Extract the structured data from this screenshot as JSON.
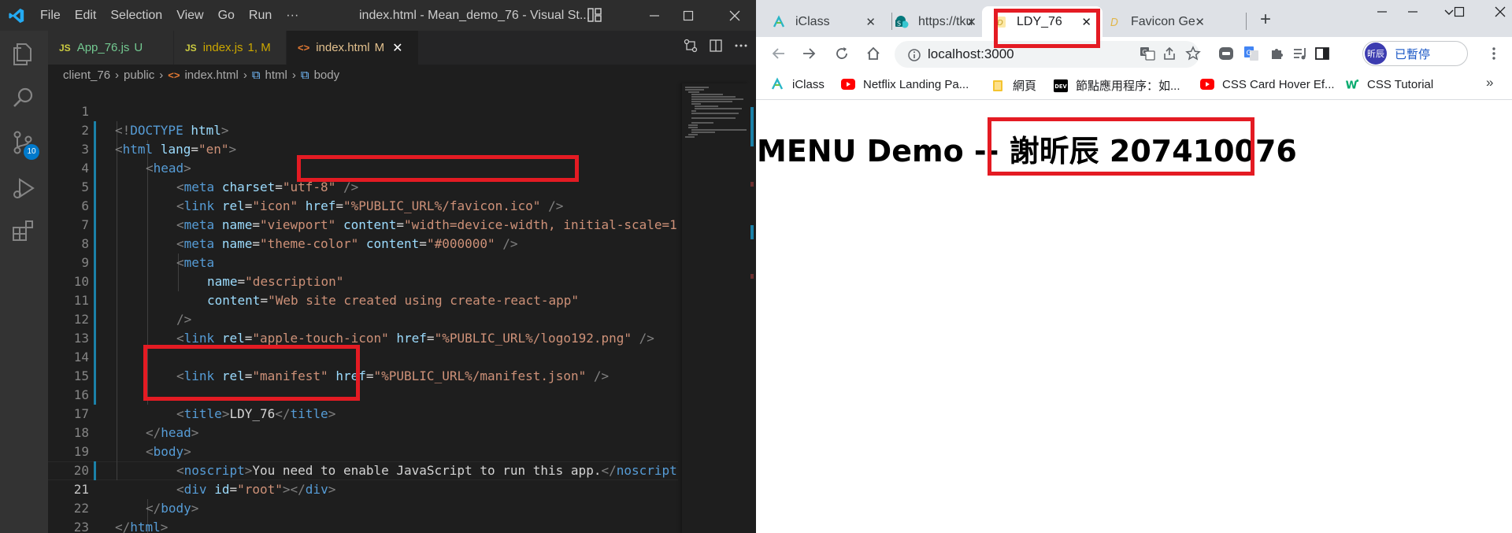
{
  "vscode": {
    "menu": [
      "File",
      "Edit",
      "Selection",
      "View",
      "Go",
      "Run",
      "···"
    ],
    "window_title": "index.html - Mean_demo_76 - Visual St...",
    "tabs": [
      {
        "badge": "JS",
        "name": "App_76.js",
        "status": "U"
      },
      {
        "badge": "JS",
        "name": "index.js",
        "status": "1, M"
      },
      {
        "badge": "<>",
        "name": "index.html",
        "status": "M",
        "close": "✕"
      }
    ],
    "breadcrumb": [
      "client_76",
      "public",
      "index.html",
      "html",
      "body"
    ],
    "source_control_badge": "10",
    "lines": [
      {
        "n": "1"
      },
      {
        "n": "2"
      },
      {
        "n": "3"
      },
      {
        "n": "4"
      },
      {
        "n": "5"
      },
      {
        "n": "6"
      },
      {
        "n": "7"
      },
      {
        "n": "8"
      },
      {
        "n": "9"
      },
      {
        "n": "10"
      },
      {
        "n": "11"
      },
      {
        "n": "12"
      },
      {
        "n": "13"
      },
      {
        "n": "14"
      },
      {
        "n": "15"
      },
      {
        "n": "16"
      },
      {
        "n": "17"
      },
      {
        "n": "18"
      },
      {
        "n": "19"
      },
      {
        "n": "20"
      },
      {
        "n": "21"
      },
      {
        "n": "22"
      },
      {
        "n": "23"
      }
    ],
    "code": {
      "l1": {
        "p1": "<!",
        "p2": "DOCTYPE",
        "p3": " html",
        "p4": ">"
      },
      "l2": {
        "tag": "html",
        "attr": "lang",
        "val": "\"en\""
      },
      "l3": {
        "tag": "head"
      },
      "l4": {
        "tag": "meta",
        "attr": "charset",
        "val": "\"utf-8\""
      },
      "l5": {
        "tag": "link",
        "attr1": "rel",
        "val1": "\"icon\"",
        "attr2": "href",
        "val2": "\"%PUBLIC_URL%/favicon.ico\""
      },
      "l6": {
        "tag": "meta",
        "attr1": "name",
        "val1": "\"viewport\"",
        "attr2": "content",
        "val2": "\"width=device-width, initial-scale=1"
      },
      "l7": {
        "tag": "meta",
        "attr1": "name",
        "val1": "\"theme-color\"",
        "attr2": "content",
        "val2": "\"#000000\""
      },
      "l8": {
        "tag": "meta"
      },
      "l9": {
        "attr": "name",
        "val": "\"description\""
      },
      "l10": {
        "attr": "content",
        "val": "\"Web site created using create-react-app\""
      },
      "l11": {
        "close": "/>"
      },
      "l12": {
        "tag": "link",
        "attr1": "rel",
        "val1": "\"apple-touch-icon\"",
        "attr2": "href",
        "val2": "\"%PUBLIC_URL%/logo192.png\""
      },
      "l14": {
        "tag": "link",
        "attr1": "rel",
        "val1": "\"manifest\"",
        "attr2": "href",
        "val2": "\"%PUBLIC_URL%/manifest.json\""
      },
      "l16": {
        "tag": "title",
        "text": "LDY_76"
      },
      "l17": {
        "tag": "head"
      },
      "l18": {
        "tag": "body"
      },
      "l19": {
        "tag": "noscript",
        "text": "You need to enable JavaScript to run this app."
      },
      "l20": {
        "tag": "div",
        "attr": "id",
        "val": "\"root\""
      },
      "l21": {
        "tag": "body"
      },
      "l22": {
        "tag": "html"
      }
    }
  },
  "chrome": {
    "tabs": [
      {
        "title": "iClass",
        "close": "✕"
      },
      {
        "title": "https://tku",
        "close": "✕"
      },
      {
        "title": "LDY_76",
        "close": "✕"
      },
      {
        "title": "Favicon Ge",
        "close": "✕"
      }
    ],
    "new_tab": "+",
    "url": "localhost:3000",
    "profile": {
      "avatar": "昕辰",
      "label": "已暫停"
    },
    "bookmarks": [
      "iClass",
      "Netflix Landing Pa...",
      "網頁",
      "節點應用程序：如...",
      "CSS Card Hover Ef...",
      "CSS Tutorial"
    ],
    "bookmark_more": "»",
    "page": {
      "heading": "MENU Demo -- 謝昕辰 207410076"
    }
  },
  "colors": {
    "annotation_red": "#e41b23",
    "vscode_blue": "#23aaf2",
    "chrome_active_tab": "#ffffff"
  }
}
